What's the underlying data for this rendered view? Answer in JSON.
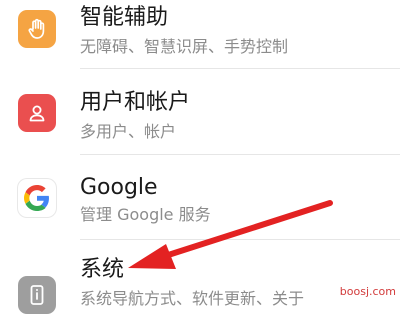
{
  "settings_list": {
    "items": [
      {
        "title": "智能辅助",
        "subtitle": "无障碍、智慧识屏、手势控制",
        "icon": "hand-icon",
        "icon_color": "#f5a443"
      },
      {
        "title": "用户和帐户",
        "subtitle": "多用户、帐户",
        "icon": "user-icon",
        "icon_color": "#ea4f4f"
      },
      {
        "title": "Google",
        "subtitle": "管理 Google 服务",
        "icon": "google-icon",
        "icon_color": "#ffffff"
      },
      {
        "title": "系统",
        "subtitle": "系统导航方式、软件更新、关于",
        "icon": "system-info-icon",
        "icon_color": "#9e9e9e"
      }
    ]
  },
  "annotation": {
    "arrow_color": "#e32222"
  },
  "watermark": "boosj.com"
}
